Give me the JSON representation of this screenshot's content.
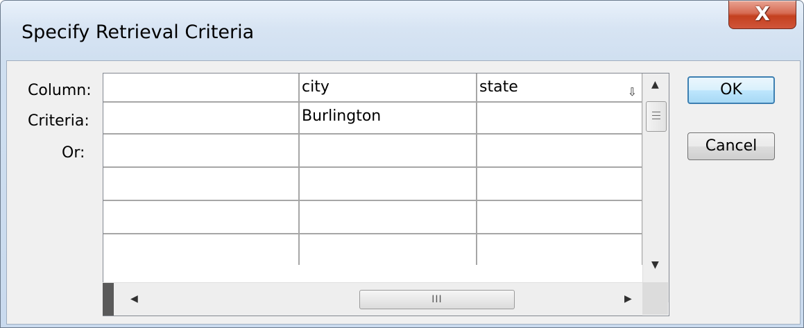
{
  "window": {
    "title": "Specify Retrieval Criteria",
    "close_glyph": "X"
  },
  "labels": {
    "column": "Column:",
    "criteria": "Criteria:",
    "or": "Or:"
  },
  "grid": {
    "columns": [
      "",
      "city",
      "state"
    ],
    "criteria_row": [
      "",
      "Burlington",
      ""
    ],
    "sort_icon": "sort-arrow-icon"
  },
  "scrollbars": {
    "up": "▲",
    "down": "▼",
    "left": "◀",
    "right": "▶",
    "h_thumb_grip": "III"
  },
  "buttons": {
    "ok": "OK",
    "cancel": "Cancel"
  }
}
